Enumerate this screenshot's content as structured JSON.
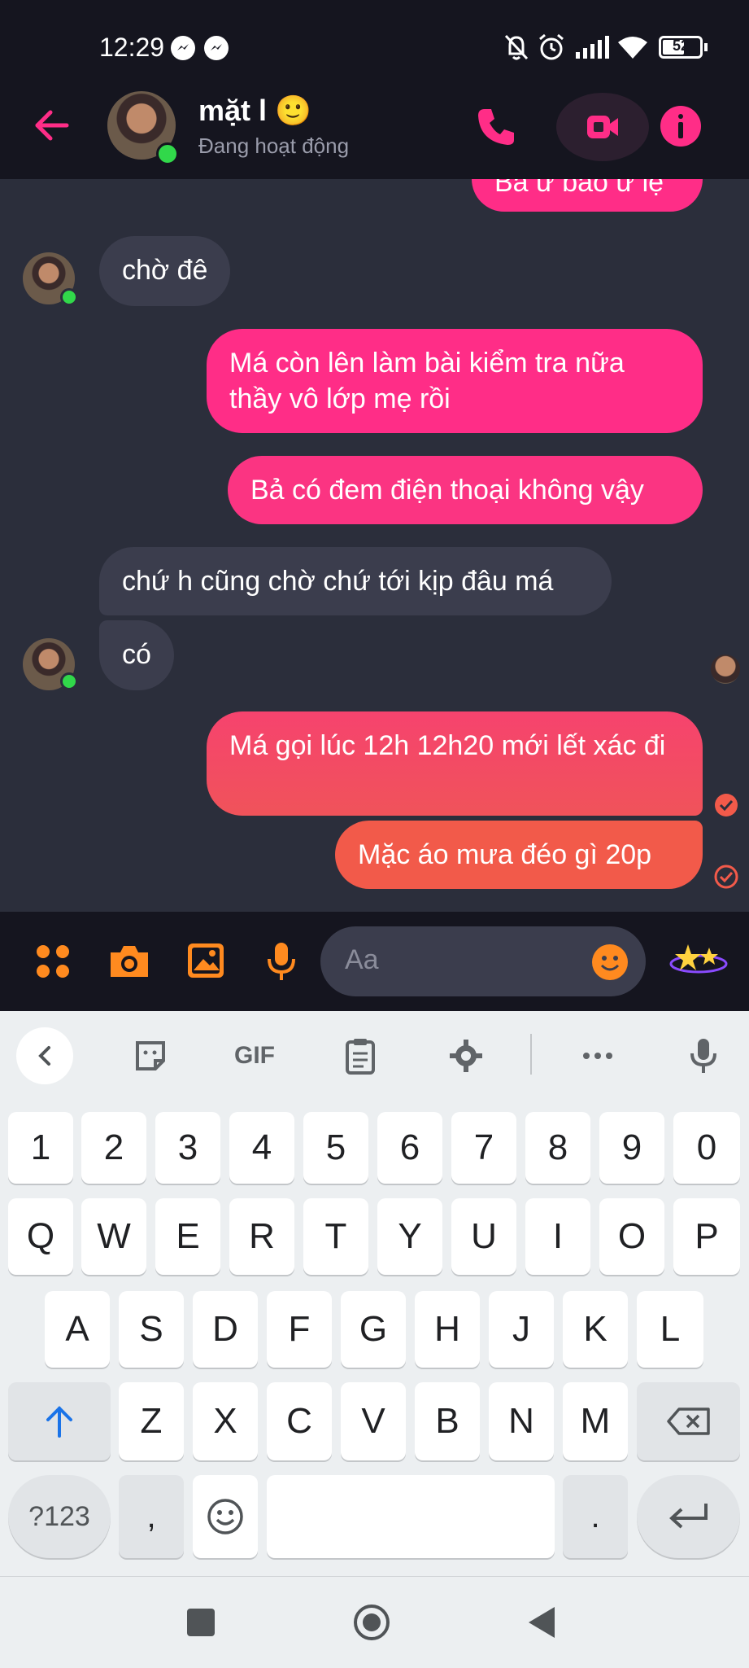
{
  "status_bar": {
    "time": "12:29",
    "battery": "52",
    "icons": [
      "messenger-icon",
      "messenger-icon",
      "mute-icon",
      "alarm-icon",
      "signal-icon",
      "wifi-icon",
      "battery-icon"
    ]
  },
  "header": {
    "contact_name": "mặt l 🙂",
    "contact_status": "Đang hoạt động",
    "icons": [
      "back-arrow-icon",
      "phone-icon",
      "video-icon",
      "info-icon"
    ]
  },
  "messages": [
    {
      "from": "me",
      "text": "Bả ừ bảo ừ lệ"
    },
    {
      "from": "them",
      "text": "chờ đê"
    },
    {
      "from": "me",
      "text": "Má còn lên làm bài kiểm tra nữa thầy vô lớp mẹ rồi"
    },
    {
      "from": "me",
      "text": "Bả có đem điện thoại không vậy"
    },
    {
      "from": "them",
      "text": "chứ h cũng chờ chứ tới kịp đâu má"
    },
    {
      "from": "them",
      "text": "có"
    },
    {
      "from": "me",
      "text": "Má gọi lúc 12h 12h20 mới lết xác đi"
    },
    {
      "from": "me",
      "text": "Mặc áo mưa đéo gì 20p"
    }
  ],
  "composer": {
    "placeholder": "Aa",
    "icons": [
      "apps-icon",
      "camera-icon",
      "image-icon",
      "microphone-icon",
      "emoji-icon",
      "effects-icon"
    ]
  },
  "keyboard": {
    "toolbar": [
      "back-chevron-icon",
      "sticker-icon",
      "GIF",
      "clipboard-icon",
      "settings-gear-icon",
      "more-icon",
      "microphone-icon"
    ],
    "gif_label": "GIF",
    "row_numbers": [
      "1",
      "2",
      "3",
      "4",
      "5",
      "6",
      "7",
      "8",
      "9",
      "0"
    ],
    "row1": [
      "Q",
      "W",
      "E",
      "R",
      "T",
      "Y",
      "U",
      "I",
      "O",
      "P"
    ],
    "row2": [
      "A",
      "S",
      "D",
      "F",
      "G",
      "H",
      "J",
      "K",
      "L"
    ],
    "row3": [
      "Z",
      "X",
      "C",
      "V",
      "B",
      "N",
      "M"
    ],
    "symbols_key": "?123",
    "comma_key": ",",
    "period_key": ".",
    "colors": {
      "accent": "#1a73e8"
    }
  },
  "colors": {
    "accent": "#ff2d87",
    "bubble_out_top": "#ff2d87",
    "bubble_out_bottom": "#f25a4a",
    "bubble_in": "#3b3d4d",
    "composer_icons": "#ff8a1f"
  }
}
